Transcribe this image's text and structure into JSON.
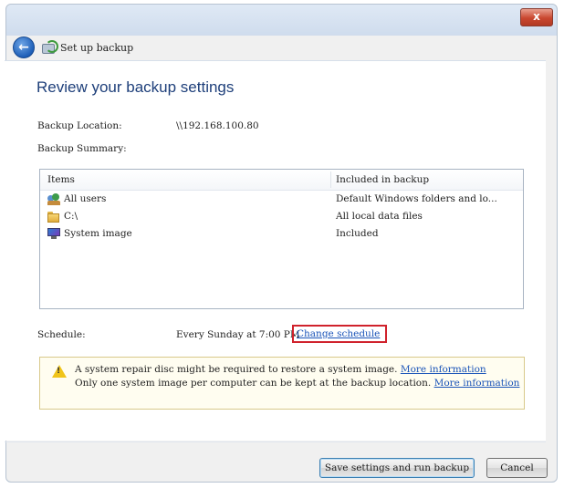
{
  "window": {
    "close_label": "x",
    "nav_title": "Set up backup"
  },
  "page": {
    "heading": "Review your backup settings"
  },
  "backup_location": {
    "label": "Backup Location:",
    "value": "\\\\192.168.100.80"
  },
  "backup_summary": {
    "label": "Backup Summary:",
    "columns": [
      "Items",
      "Included in backup"
    ],
    "rows": [
      {
        "icon": "users-icon",
        "name": "All users",
        "included": "Default Windows folders and lo..."
      },
      {
        "icon": "folder-icon",
        "name": "C:\\",
        "included": "All local data files"
      },
      {
        "icon": "system-image-icon",
        "name": "System image",
        "included": "Included"
      }
    ]
  },
  "schedule": {
    "label": "Schedule:",
    "value": "Every Sunday at 7:00 PM",
    "change_link": "Change schedule"
  },
  "info": {
    "line1": "A system repair disc might be required to restore a system image.",
    "line1_link": "More information",
    "line2": "Only one system image per computer can be kept at the backup location.",
    "line2_link": "More information"
  },
  "buttons": {
    "save_run": "Save settings and run backup",
    "cancel": "Cancel"
  },
  "colors": {
    "heading": "#1e3f7a",
    "link": "#1b54b8",
    "highlight_box": "#d0222c",
    "warning": "#f0c419"
  }
}
